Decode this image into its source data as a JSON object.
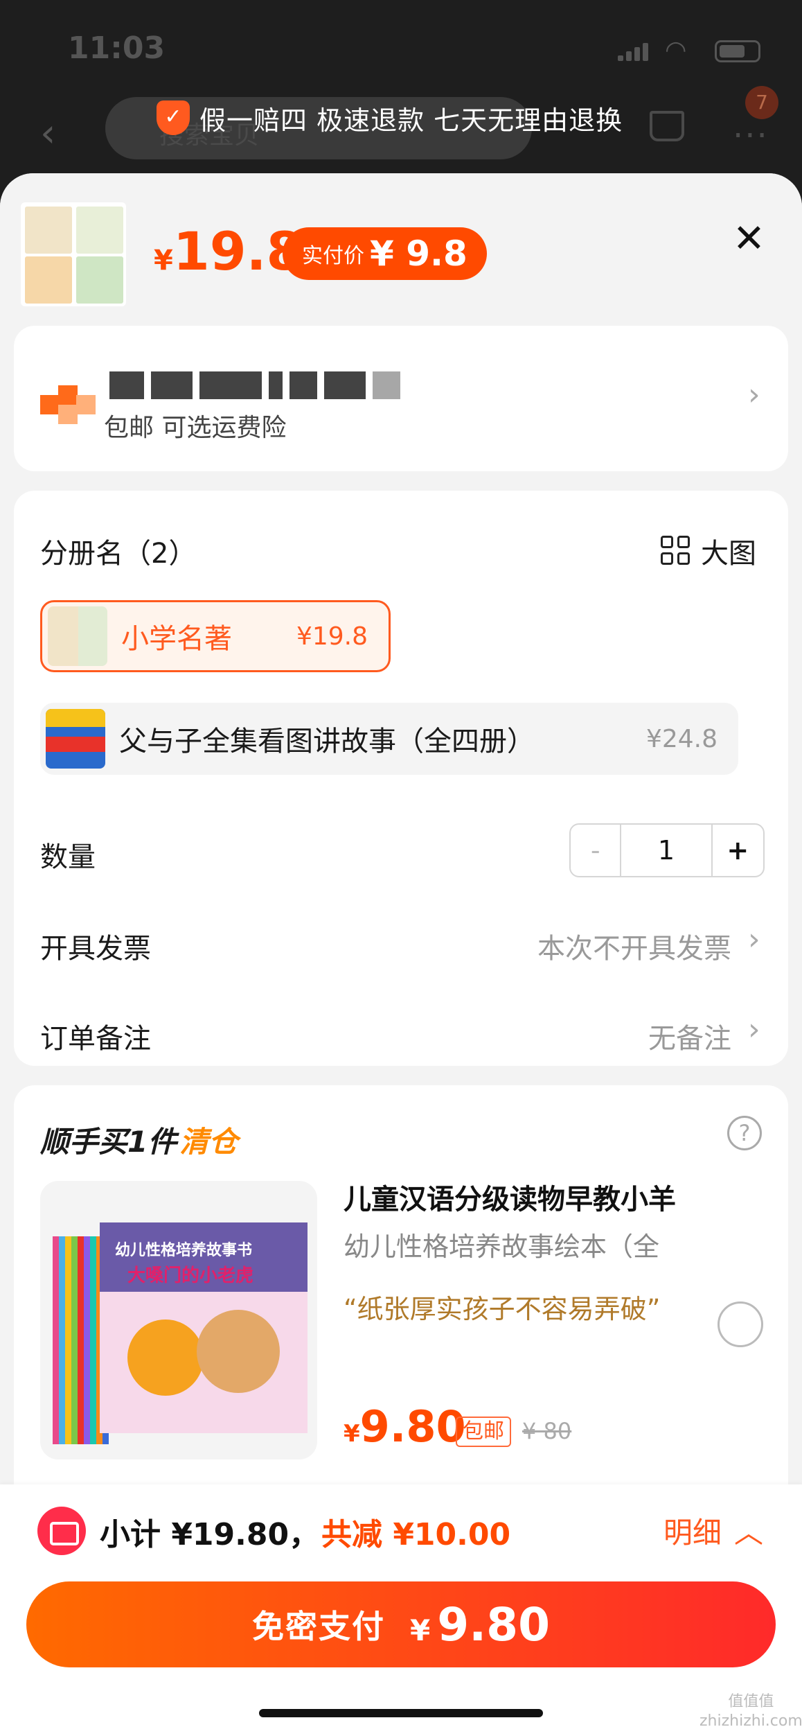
{
  "status": {
    "time": "11:03"
  },
  "bg": {
    "search_placeholder": "搜索宝贝",
    "badge": "7"
  },
  "guarantee": "假一赔四 极速退款 七天无理由退换",
  "header": {
    "price_currency": "¥",
    "price": "19.8",
    "pay_label": "实付价",
    "pay_value": "¥ 9.8",
    "close": "✕"
  },
  "address": {
    "sub": "包邮  可选运费险"
  },
  "spec": {
    "title": "分册名（2）",
    "big_image": "大图",
    "options": [
      {
        "name": "小学名著",
        "price": "¥19.8",
        "selected": true
      },
      {
        "name": "父与子全集看图讲故事（全四册）",
        "price": "¥24.8",
        "selected": false
      }
    ]
  },
  "quantity": {
    "label": "数量",
    "minus": "-",
    "value": "1",
    "plus": "+"
  },
  "invoice": {
    "label": "开具发票",
    "value": "本次不开具发票"
  },
  "remark": {
    "label": "订单备注",
    "value": "无备注"
  },
  "upsell": {
    "title_prefix": "顺手买1件",
    "title_highlight": "清仓",
    "help": "?",
    "cover_line1": "幼儿性格培养故事书",
    "cover_line2": "大嗓门的小老虎",
    "name": "儿童汉语分级读物早教小羊",
    "sub": "幼儿性格培养故事绘本（全",
    "quote": "“纸张厚实孩子不容易弄破”",
    "price_currency": "¥",
    "price": "9.80",
    "tag": "包邮",
    "orig_price": "¥ 80"
  },
  "footer": {
    "subtotal": "小计 ¥19.80，",
    "discount": "共减 ¥10.00",
    "detail": "明细",
    "pay_label": "免密支付",
    "pay_currency": "¥",
    "pay_amount": "9.80",
    "watermark": "值值值 zhizhizhi.com"
  },
  "colors": {
    "accent": "#ff4a00",
    "upsell_highlight": "#ff8a00",
    "coupon": "#ff2d4a"
  }
}
